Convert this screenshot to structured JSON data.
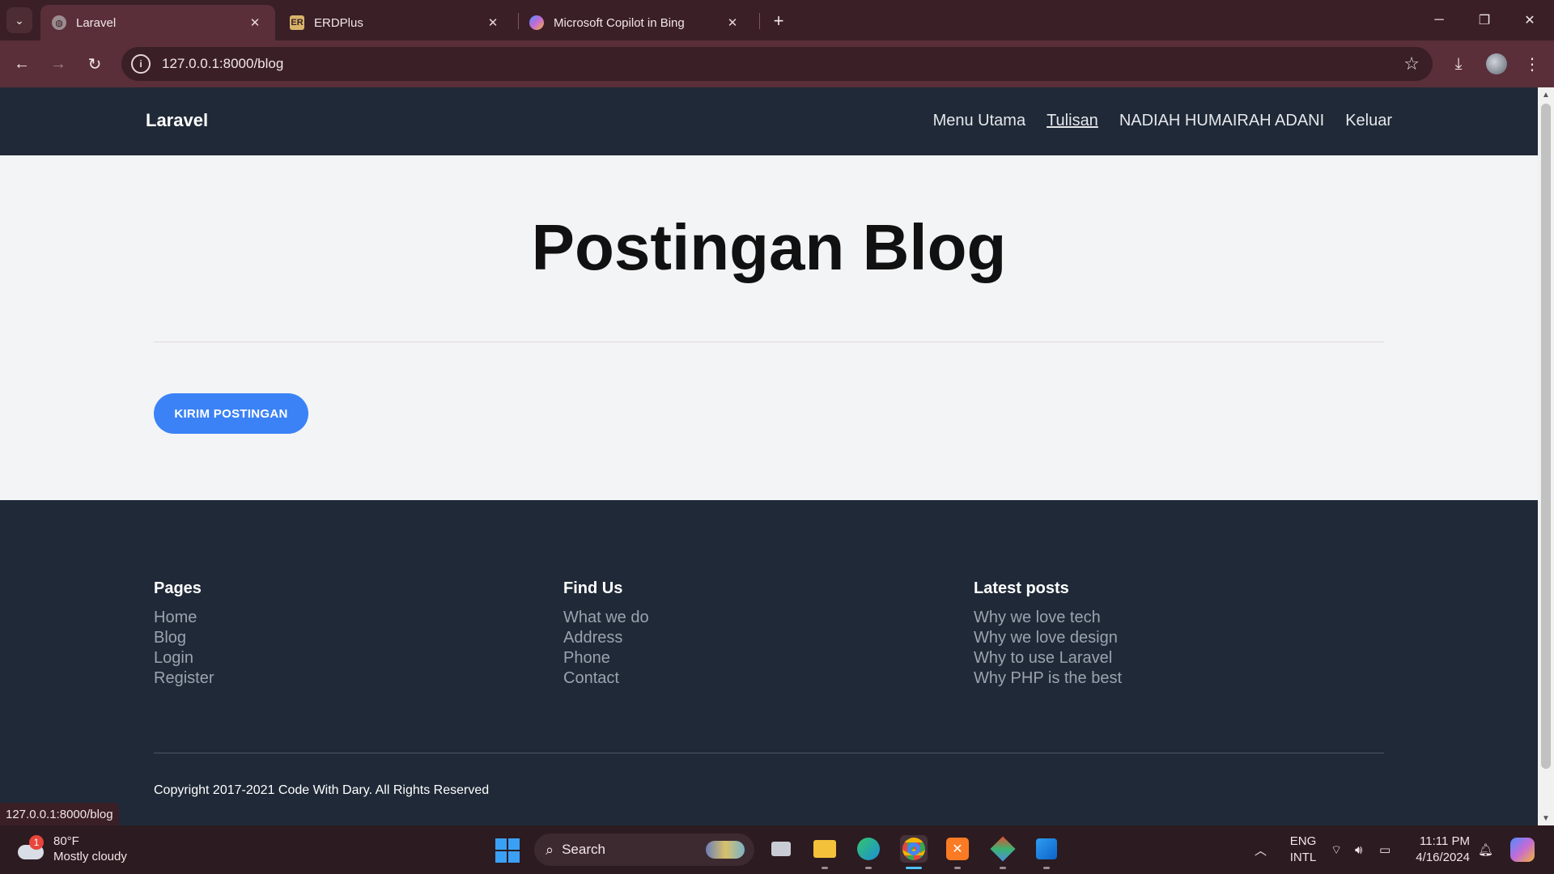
{
  "browser": {
    "tabs": [
      {
        "title": "Laravel",
        "favicon": "globe-icon",
        "active": true
      },
      {
        "title": "ERDPlus",
        "favicon": "erdplus-icon",
        "favicon_text": "ER",
        "active": false
      },
      {
        "title": "Microsoft Copilot in Bing",
        "favicon": "copilot-icon",
        "active": false
      }
    ],
    "url": "127.0.0.1:8000/blog",
    "status_url": "127.0.0.1:8000/blog"
  },
  "site": {
    "brand": "Laravel",
    "nav": [
      "Menu Utama",
      "Tulisan",
      "NADIAH HUMAIRAH ADANI",
      "Keluar"
    ],
    "current_nav": "Tulisan",
    "title": "Postingan Blog",
    "cta_label": "KIRIM POSTINGAN",
    "accent_color": "#3b82f6"
  },
  "footer": {
    "columns": [
      {
        "heading": "Pages",
        "links": [
          "Home",
          "Blog",
          "Login",
          "Register"
        ]
      },
      {
        "heading": "Find Us",
        "links": [
          "What we do",
          "Address",
          "Phone",
          "Contact"
        ]
      },
      {
        "heading": "Latest posts",
        "links": [
          "Why we love tech",
          "Why we love design",
          "Why to use Laravel",
          "Why PHP is the best"
        ]
      }
    ],
    "copyright": "Copyright 2017-2021 Code With Dary. All Rights Reserved"
  },
  "taskbar": {
    "weather": {
      "temp": "80°F",
      "condition": "Mostly cloudy",
      "badge": "1"
    },
    "search_placeholder": "Search",
    "language": {
      "line1": "ENG",
      "line2": "INTL"
    },
    "time": "11:11 PM",
    "date": "4/16/2024"
  }
}
